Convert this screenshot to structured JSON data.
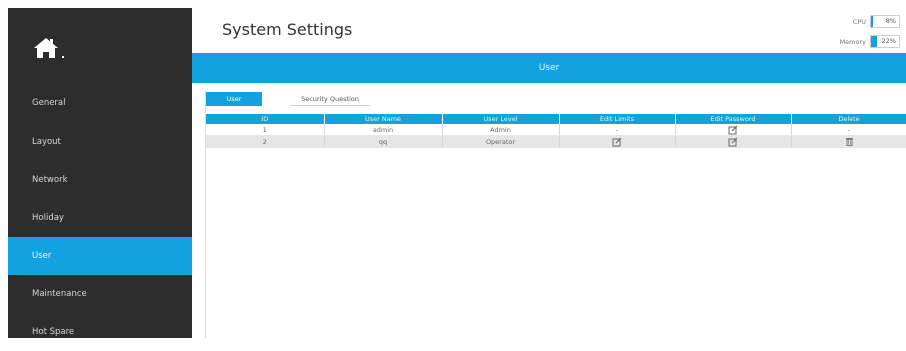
{
  "header": {
    "title": "System Settings"
  },
  "monitor": {
    "cpu_label": "CPU",
    "cpu_value": "8%",
    "cpu_fraction": 0.08,
    "memory_label": "Memory",
    "memory_value": "22%",
    "memory_fraction": 0.22
  },
  "sidebar": {
    "home_icon": "home-icon",
    "items": [
      {
        "label": "General"
      },
      {
        "label": "Layout"
      },
      {
        "label": "Network"
      },
      {
        "label": "Holiday"
      },
      {
        "label": "User",
        "active": true
      },
      {
        "label": "Maintenance"
      },
      {
        "label": "Hot Spare"
      }
    ]
  },
  "section": {
    "title": "User"
  },
  "tabs": [
    {
      "label": "User",
      "active": true
    },
    {
      "label": "Security Question"
    }
  ],
  "table": {
    "columns": [
      "ID",
      "User Name",
      "User Level",
      "Edit Limits",
      "Edit Password",
      "Delete"
    ],
    "rows": [
      {
        "id": "1",
        "name": "admin",
        "level": "Admin",
        "limits": "-",
        "password": "edit-icon",
        "delete": "-"
      },
      {
        "id": "2",
        "name": "qq",
        "level": "Operator",
        "limits": "edit-icon",
        "password": "edit-icon",
        "delete": "trash-icon"
      }
    ]
  },
  "colors": {
    "accent": "#13a2df",
    "sidebar": "#2d2d2d"
  }
}
